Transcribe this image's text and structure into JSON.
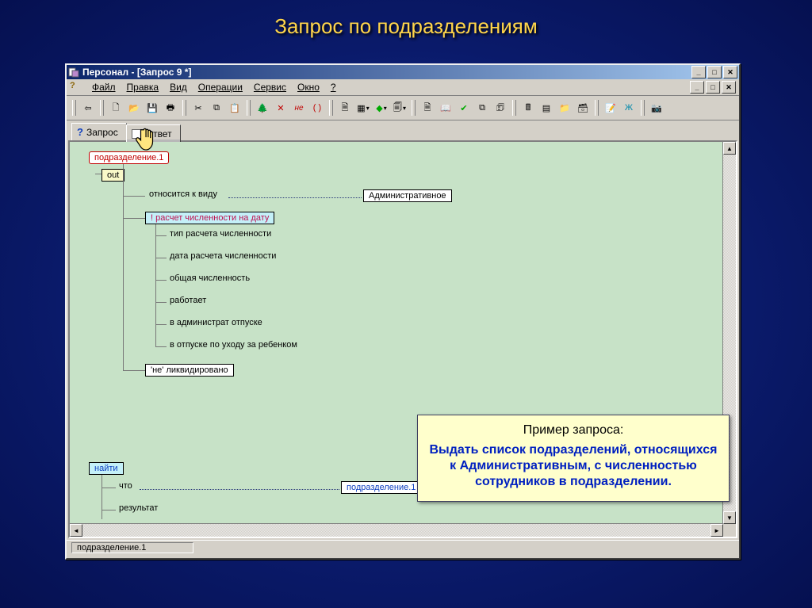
{
  "slide_title": "Запрос по подразделениям",
  "window": {
    "title": "Персонал - [Запрос 9 *]"
  },
  "menu": {
    "items": [
      "Файл",
      "Правка",
      "Вид",
      "Операции",
      "Сервис",
      "Окно",
      "?"
    ]
  },
  "tabs": {
    "query": "Запрос",
    "answer": "Ответ"
  },
  "tree": {
    "root": "подразделение.1",
    "out": "out",
    "rel_kind_label": "относится к виду",
    "rel_kind_value": "Административное",
    "calc_header": "! расчет численности на дату",
    "calc_items": [
      "тип расчета численности",
      "дата расчета численности",
      "общая численность",
      "работает",
      "в администрат отпуске",
      "в отпуске по уходу за ребенком"
    ],
    "liquidated": "'не' ликвидировано",
    "find": "найти",
    "what_label": "что",
    "what_ref": "подразделение.1",
    "result_label": "результат"
  },
  "statusbar": "подразделение.1",
  "callout": {
    "title": "Пример запроса:",
    "body": "Выдать список подразделений, относящихся к Административным, с численностью сотрудников в подразделении."
  },
  "sysbuttons": {
    "min": "_",
    "max": "□",
    "close": "✕"
  },
  "scroll": {
    "up": "▲",
    "down": "▼",
    "left": "◄",
    "right": "►"
  }
}
